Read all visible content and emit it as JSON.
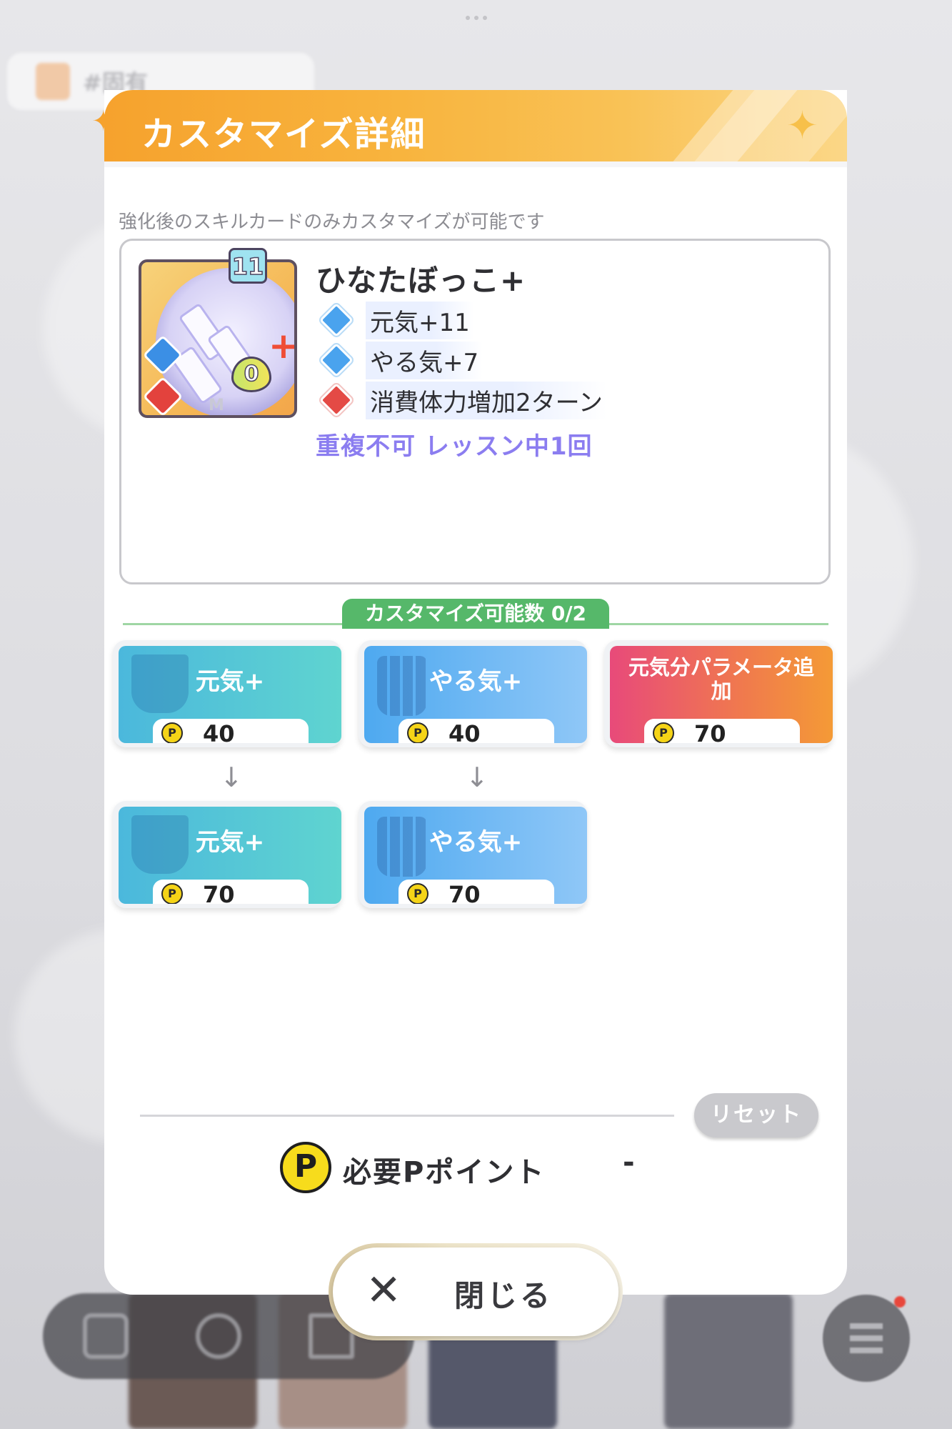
{
  "background": {
    "tab_label": "#固有"
  },
  "dialog": {
    "title": "カスタマイズ詳細",
    "hint": "強化後のスキルカードのみカスタマイズが可能です"
  },
  "card": {
    "name": "ひなたぼっこ+",
    "level": "11",
    "cost": "0",
    "rarity_mark": "M",
    "effects": [
      {
        "text": "元気+11",
        "icon": "genki-icon"
      },
      {
        "text": "やる気+7",
        "icon": "yaruki-icon"
      },
      {
        "text": "消費体力増加2ターン",
        "icon": "stamina-up-icon"
      }
    ],
    "note": "重複不可 レッスン中1回"
  },
  "customize": {
    "count_label": "カスタマイズ可能数 0/2",
    "options": [
      {
        "label": "元気+",
        "cost": "40"
      },
      {
        "label": "やる気+",
        "cost": "40"
      },
      {
        "label": "元気分パラメータ追加",
        "cost": "70"
      },
      {
        "label": "元気+",
        "cost": "70"
      },
      {
        "label": "やる気+",
        "cost": "70"
      }
    ]
  },
  "footer": {
    "reset_label": "リセット",
    "required_label": "必要Pポイント",
    "required_value": "-",
    "coin_symbol": "P",
    "close_label": "閉じる"
  },
  "colors": {
    "header_orange": "#f6a22d",
    "count_green": "#56b86a",
    "note_purple": "#8b7df0"
  }
}
